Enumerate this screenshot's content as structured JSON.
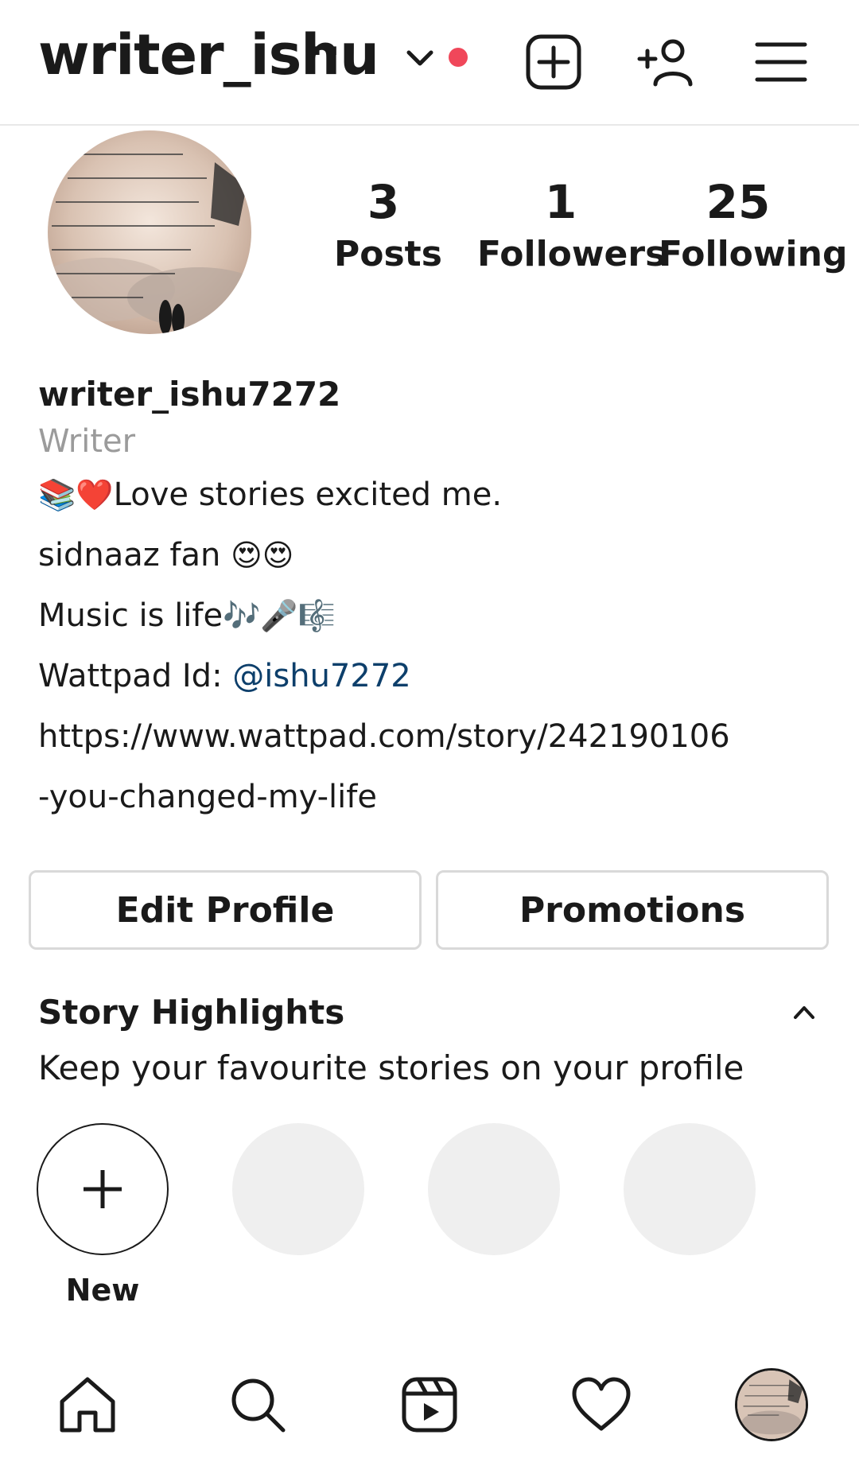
{
  "header": {
    "username": "writer_ishu",
    "ellipsis": "···",
    "notification_color": "#f0475a"
  },
  "profile": {
    "stats": [
      {
        "value": "3",
        "label": "Posts"
      },
      {
        "value": "1",
        "label": "Followers"
      },
      {
        "value": "25",
        "label": "Following"
      }
    ]
  },
  "bio": {
    "name": "writer_ishu7272",
    "category": "Writer",
    "line1_emoji": "📚❤️",
    "line1_text": "Love stories excited me.",
    "line2_text": "sidnaaz fan ",
    "line2_emoji": "😍😍",
    "line3_text": "Music is life",
    "line3_emoji": "🎶🎤🎼",
    "line4_label": "Wattpad Id: ",
    "line4_handle": "@ishu7272",
    "link_part1": "https://www.wattpad.com/story/242190106",
    "link_part2": "-you-changed-my-life"
  },
  "actions": {
    "edit_label": "Edit Profile",
    "promotions_label": "Promotions"
  },
  "highlights": {
    "title": "Story Highlights",
    "subtitle": "Keep your favourite stories on your profile",
    "new_label": "New"
  },
  "icons": {
    "add_post": "plus-square-icon",
    "add_user": "add-person-icon",
    "menu": "hamburger-menu-icon",
    "home": "home-icon",
    "search": "search-icon",
    "reels": "reels-icon",
    "activity": "heart-icon"
  }
}
